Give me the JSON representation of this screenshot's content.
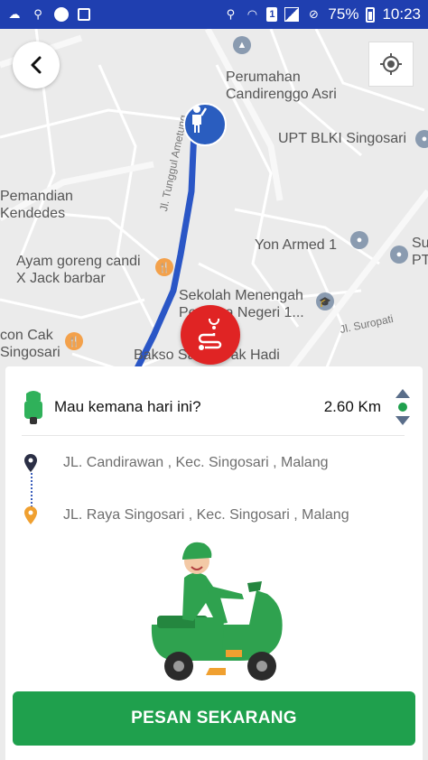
{
  "status_bar": {
    "battery_percent": "75%",
    "time": "10:23",
    "sim": "1"
  },
  "map": {
    "labels": {
      "perumahan": "Perumahan\nCandirenggo Asri",
      "upt_blki": "UPT BLKI Singosari",
      "pemandian": "Pemandian\nKendedes",
      "ayam_goreng": "Ayam goreng candi\nX Jack barbar",
      "yon_armed": "Yon Armed 1",
      "su_pt": "Su\nPT",
      "sekolah": "Sekolah Menengah\nPertama Negeri 1...",
      "jl_suropati": "Jl. Suropati",
      "jl_tunggul": "Jl. Tunggul Ametung",
      "con_cak": "con Cak\nSingosari",
      "bakso": "Bakso Sahar Cak Hadi"
    },
    "route_color": "#2a56c6"
  },
  "trip": {
    "question": "Mau kemana hari ini?",
    "distance": "2.60 Km"
  },
  "addresses": {
    "origin": "JL. Candirawan , Kec. Singosari , Malang",
    "destination": "JL. Raya Singosari , Kec. Singosari , Malang"
  },
  "actions": {
    "order_label": "PESAN SEKARANG"
  },
  "colors": {
    "status_bar": "#1f3fb0",
    "route": "#2a56c6",
    "order_button": "#1fa04d",
    "route_button": "#e02424",
    "origin_marker": "#2b2f45",
    "destination_marker": "#f0a030"
  }
}
